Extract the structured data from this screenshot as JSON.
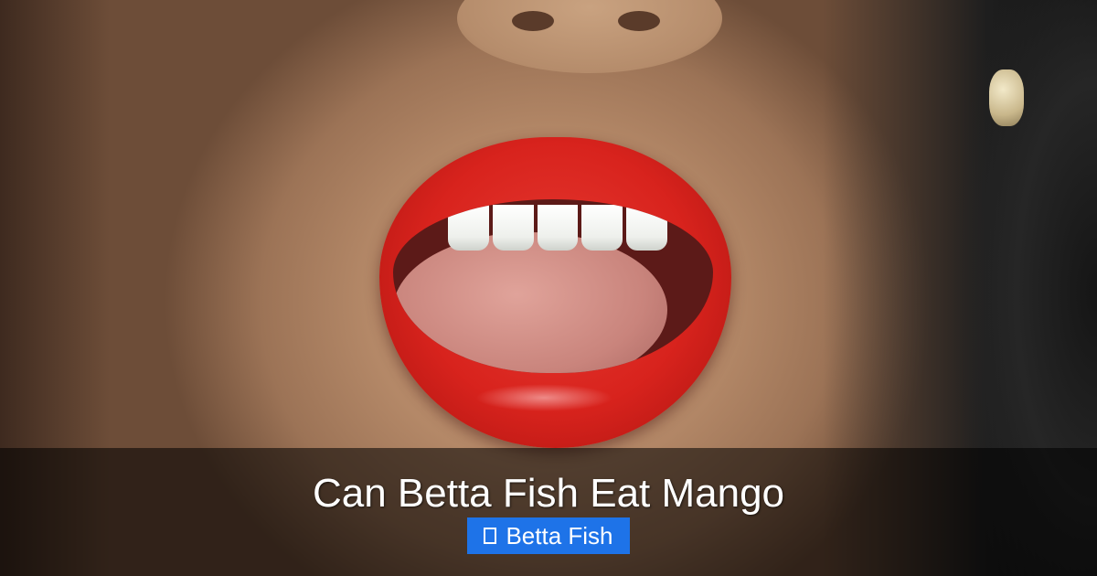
{
  "caption": {
    "title": "Can Betta Fish Eat Mango",
    "category": {
      "label": "Betta Fish",
      "icon": "missing-glyph-icon",
      "color": "#1e73e8"
    }
  },
  "overlay": {
    "bar_color": "#000000"
  }
}
